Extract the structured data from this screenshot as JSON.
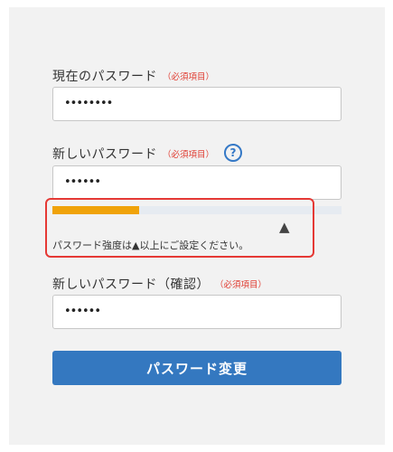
{
  "form": {
    "current_password": {
      "label": "現在のパスワード",
      "required": "（必須項目）",
      "value": "••••••••"
    },
    "new_password": {
      "label": "新しいパスワード",
      "required": "（必須項目）",
      "value": "••••••",
      "help_icon": "?"
    },
    "strength": {
      "level_fraction": 0.3,
      "marker": "▲",
      "message": "パスワード強度は▲以上にご設定ください。",
      "fill_color": "#f0a30a",
      "highlight_color": "#e53935"
    },
    "confirm_password": {
      "label": "新しいパスワード（確認）",
      "required": "（必須項目）",
      "value": "••••••"
    },
    "submit_label": "パスワード変更",
    "accent_color": "#3478c0"
  }
}
